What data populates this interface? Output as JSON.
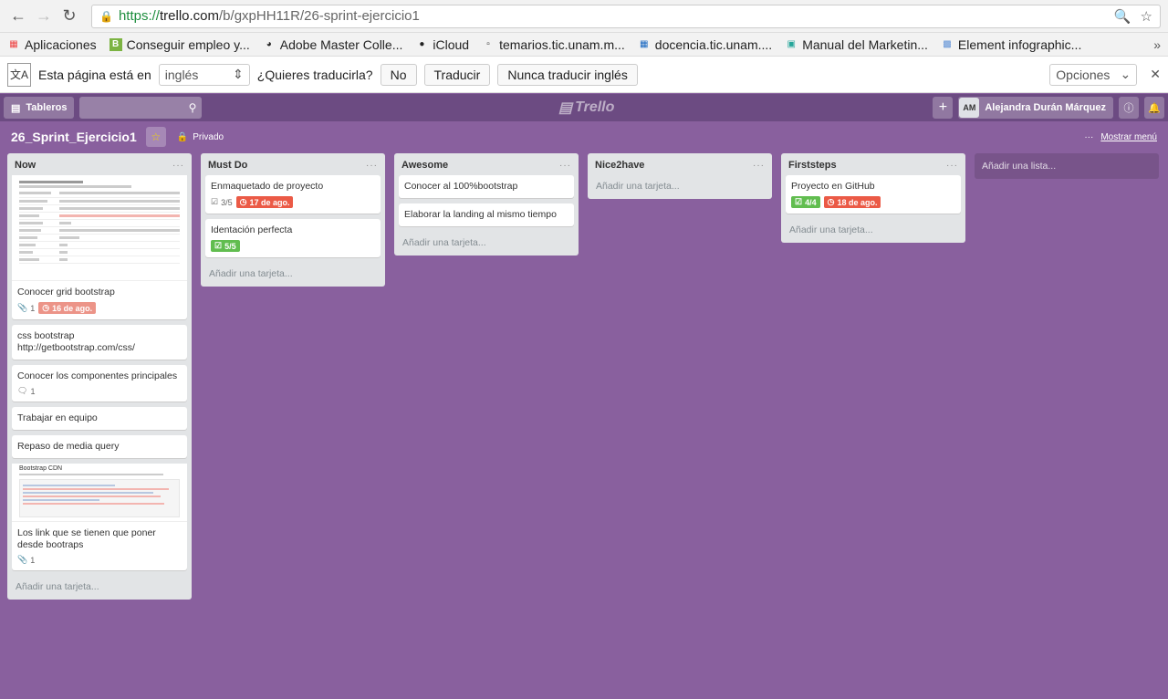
{
  "browser": {
    "url_scheme": "https://",
    "url_host": "trello.com",
    "url_path": "/b/gxpHH11R/26-sprint-ejercicio1",
    "bookmarks": [
      {
        "label": "Aplicaciones",
        "icon": "apps-grid-icon"
      },
      {
        "label": "Conseguir empleo y...",
        "icon": "bookmark-b-icon"
      },
      {
        "label": "Adobe Master Colle...",
        "icon": "bookmark-bowl-icon"
      },
      {
        "label": "iCloud",
        "icon": "apple-icon"
      },
      {
        "label": "temarios.tic.unam.m...",
        "icon": "page-icon"
      },
      {
        "label": "docencia.tic.unam....",
        "icon": "bookmark-grid-icon"
      },
      {
        "label": "Manual del Marketin...",
        "icon": "bookmark-square-icon"
      },
      {
        "label": "Element infographic...",
        "icon": "bookmark-image-icon"
      }
    ]
  },
  "translate": {
    "prefix": "Esta página está en",
    "language": "inglés",
    "question": "¿Quieres traducirla?",
    "no": "No",
    "translate": "Traducir",
    "never": "Nunca traducir inglés",
    "options": "Opciones"
  },
  "header": {
    "boards": "Tableros",
    "logo": "Trello",
    "avatar_initials": "AM",
    "user_name": "Alejandra Durán Márquez"
  },
  "board": {
    "title": "26_Sprint_Ejercicio1",
    "visibility": "Privado",
    "show_menu": "Mostrar menú"
  },
  "lists": [
    {
      "title": "Now",
      "add_card": "Añadir una tarjeta...",
      "cards": [
        {
          "title": "Conocer grid bootstrap",
          "cover": "grid",
          "attachments": "1",
          "due": "16 de ago."
        },
        {
          "title": "css bootstrap http://getbootstrap.com/css/"
        },
        {
          "title": "Conocer los componentes principales",
          "comments": "1"
        },
        {
          "title": "Trabajar en equipo"
        },
        {
          "title": "Repaso de media query"
        },
        {
          "title": "Los link que se tienen que poner desde bootraps",
          "cover": "cdn",
          "cover_title": "Bootstrap CDN",
          "attachments": "1"
        }
      ]
    },
    {
      "title": "Must Do",
      "add_card": "Añadir una tarjeta...",
      "cards": [
        {
          "title": "Enmaquetado de proyecto",
          "checklist": "3/5",
          "due": "17 de ago."
        },
        {
          "title": "Identación perfecta",
          "checklist_done": "5/5"
        }
      ]
    },
    {
      "title": "Awesome",
      "add_card": "Añadir una tarjeta...",
      "cards": [
        {
          "title": "Conocer al 100%bootstrap"
        },
        {
          "title": "Elaborar la landing al mismo tiempo"
        }
      ]
    },
    {
      "title": "Nice2have",
      "add_card": "Añadir una tarjeta...",
      "cards": []
    },
    {
      "title": "Firststeps",
      "add_card": "Añadir una tarjeta...",
      "cards": [
        {
          "title": "Proyecto en GitHub",
          "checklist_done": "4/4",
          "due": "18 de ago."
        }
      ]
    }
  ],
  "add_list": "Añadir una lista...",
  "colors": {
    "board_bg": "#89609e",
    "header_bg": "#6c4b82",
    "due_red": "#eb5a46",
    "check_green": "#61bd4f"
  }
}
